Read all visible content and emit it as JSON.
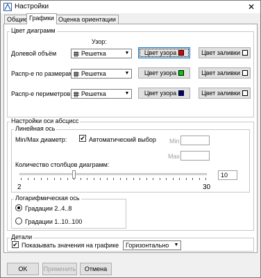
{
  "window": {
    "title": "Настройки",
    "close_glyph": "✕"
  },
  "tabs": [
    "Общие",
    "Графики",
    "Оценка ориентации"
  ],
  "active_tab": "Графики",
  "chart_color": {
    "group_label": "Цвет диаграмм",
    "pattern_header": "Узор:",
    "rows": [
      {
        "label": "Долевой объём",
        "pattern": "Решетка",
        "pattern_button": "Цвет узора",
        "pattern_color": "#e00000",
        "fill_button": "Цвет заливки",
        "fill_color": "#ffffff"
      },
      {
        "label": "Распр-е по размерам",
        "pattern": "Решетка",
        "pattern_button": "Цвет узора",
        "pattern_color": "#00cc00",
        "fill_button": "Цвет заливки",
        "fill_color": "#ffffff"
      },
      {
        "label": "Распр-е периметров",
        "pattern": "Решетка",
        "pattern_button": "Цвет узора",
        "pattern_color": "#000080",
        "fill_button": "Цвет заливки",
        "fill_color": "#ffffff"
      }
    ]
  },
  "axis": {
    "group_label": "Настройки оси абсцисс",
    "linear": {
      "group_label": "Линейная ось",
      "minmax_label": "Min/Max диаметр:",
      "auto_label": "Автоматический выбор",
      "auto_checked": true,
      "min_label": "Min",
      "max_label": "Max",
      "min_value": "",
      "max_value": "",
      "bars_label": "Количество столбцов диаграмм:",
      "slider_min": "2",
      "slider_max": "30",
      "slider_value": "10",
      "slider_fraction": 0.286
    },
    "log": {
      "group_label": "Логарифмическая ось",
      "options": [
        "Градации 2..4..8",
        "Градации 1..10..100"
      ],
      "selected": 0
    }
  },
  "details": {
    "group_label": "Детали",
    "show_values_label": "Показывать значения на графике",
    "show_values_checked": true,
    "orientation": "Горизонтально"
  },
  "footer": {
    "ok": "OK",
    "apply": "Применить",
    "cancel": "Отмена"
  },
  "icons": {
    "pattern_icon": "grid-icon",
    "dropdown": "chevron-down-icon",
    "check": "✔"
  }
}
